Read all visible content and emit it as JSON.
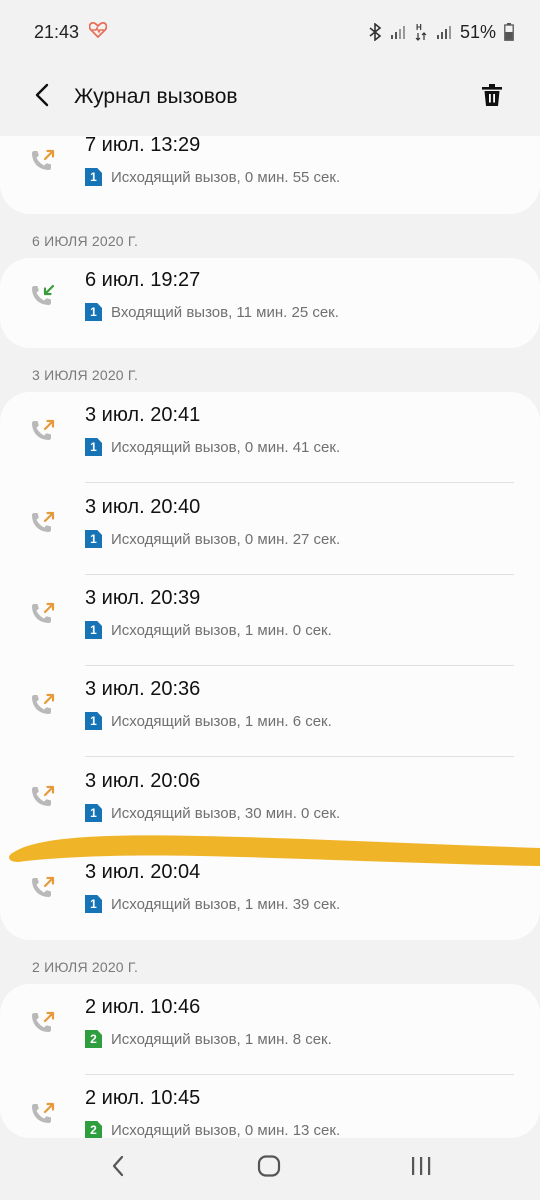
{
  "status_bar": {
    "time": "21:43",
    "battery": "51%"
  },
  "app_bar": {
    "title": "Журнал вызовов"
  },
  "colors": {
    "outgoing": "#e69a3a",
    "incoming": "#3c9b3c",
    "sim1": "#1674b6",
    "sim2": "#2f9e3f",
    "highlight": "#f0b429"
  },
  "sections": [
    {
      "header": "",
      "entries": [
        {
          "when": "7 июл. 13:29",
          "sim": "1",
          "detail": "Исходящий вызов, 0 мин. 55 сек.",
          "direction": "outgoing"
        }
      ]
    },
    {
      "header": "6 ИЮЛЯ 2020 Г.",
      "entries": [
        {
          "when": "6 июл. 19:27",
          "sim": "1",
          "detail": "Входящий вызов, 11 мин. 25 сек.",
          "direction": "incoming"
        }
      ]
    },
    {
      "header": "3 ИЮЛЯ 2020 Г.",
      "entries": [
        {
          "when": "3 июл. 20:41",
          "sim": "1",
          "detail": "Исходящий вызов, 0 мин. 41 сек.",
          "direction": "outgoing"
        },
        {
          "when": "3 июл. 20:40",
          "sim": "1",
          "detail": "Исходящий вызов, 0 мин. 27 сек.",
          "direction": "outgoing"
        },
        {
          "when": "3 июл. 20:39",
          "sim": "1",
          "detail": "Исходящий вызов, 1 мин. 0 сек.",
          "direction": "outgoing"
        },
        {
          "when": "3 июл. 20:36",
          "sim": "1",
          "detail": "Исходящий вызов, 1 мин. 6 сек.",
          "direction": "outgoing"
        },
        {
          "when": "3 июл. 20:06",
          "sim": "1",
          "detail": "Исходящий вызов, 30 мин. 0 сек.",
          "direction": "outgoing"
        },
        {
          "when": "3 июл. 20:04",
          "sim": "1",
          "detail": "Исходящий вызов, 1 мин. 39 сек.",
          "direction": "outgoing"
        }
      ]
    },
    {
      "header": "2 ИЮЛЯ 2020 Г.",
      "entries": [
        {
          "when": "2 июл. 10:46",
          "sim": "2",
          "detail": "Исходящий вызов, 1 мин. 8 сек.",
          "direction": "outgoing"
        },
        {
          "when": "2 июл. 10:45",
          "sim": "2",
          "detail": "Исходящий вызов, 0 мин. 13 сек.",
          "direction": "outgoing"
        }
      ]
    }
  ],
  "icons": {
    "back": "back-arrow-icon",
    "delete": "trash-icon",
    "outgoing": "outgoing-call-icon",
    "incoming": "incoming-call-icon",
    "nav": [
      "nav-back-icon",
      "nav-home-icon",
      "nav-recents-icon"
    ]
  }
}
